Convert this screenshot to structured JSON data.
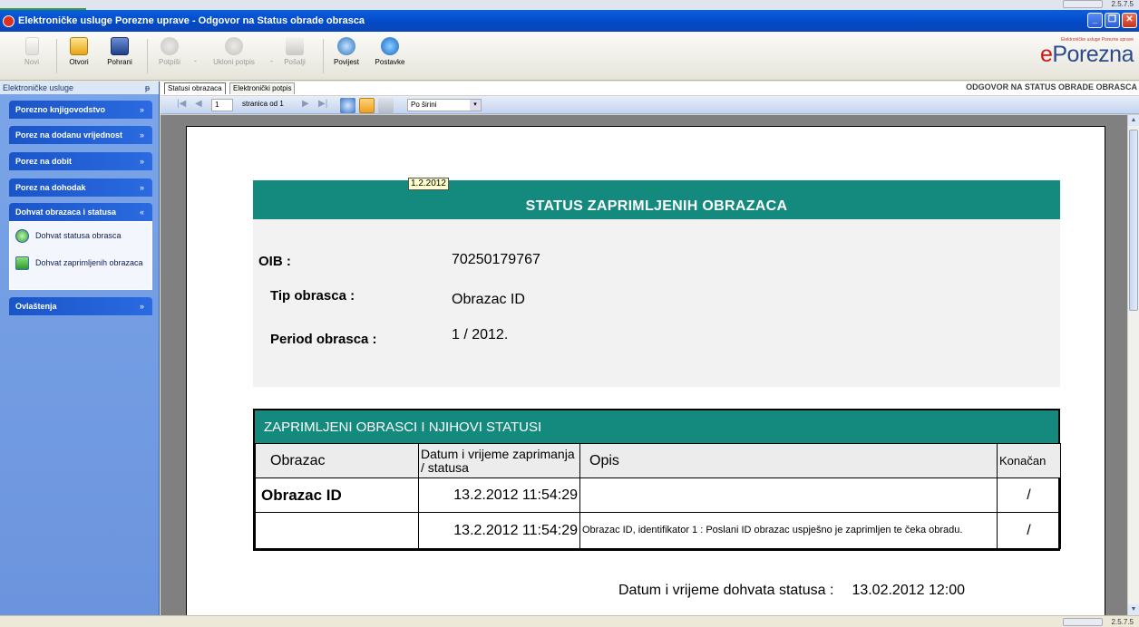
{
  "version": "2.5.7.5",
  "window": {
    "title": "Elektroničke usluge Porezne uprave - Odgovor na Status obrade obrasca",
    "minimize": "_",
    "restore": "❐",
    "close": "✕"
  },
  "toolbar": {
    "items": [
      {
        "label": "Novi",
        "icon": "new-document-icon",
        "enabled": false
      },
      {
        "label": "Otvori",
        "icon": "open-folder-icon",
        "enabled": true
      },
      {
        "label": "Pohrani",
        "icon": "save-icon",
        "enabled": true
      },
      {
        "label": "Potpiši",
        "icon": "sign-icon",
        "enabled": false
      },
      {
        "label": "Ukloni potpis",
        "icon": "remove-signature-icon",
        "enabled": false
      },
      {
        "label": "Pošalji",
        "icon": "send-icon",
        "enabled": false
      },
      {
        "label": "Povijest",
        "icon": "history-icon",
        "enabled": true
      },
      {
        "label": "Postavke",
        "icon": "settings-gear-icon",
        "enabled": true
      }
    ],
    "logo": {
      "prefix": "e",
      "text": "Porezna",
      "tagline": "Elektroničke usluge Porezne uprave"
    }
  },
  "sidebar": {
    "header": "Elektroničke usluge",
    "pin": "ᵽ",
    "groups": [
      {
        "label": "Porezno knjigovodstvo",
        "chevron": "»"
      },
      {
        "label": "Porez na dodanu vrijednost",
        "chevron": "»"
      },
      {
        "label": "Porez na dobit",
        "chevron": "»"
      },
      {
        "label": "Porez na dohodak",
        "chevron": "»"
      },
      {
        "label": "Dohvat obrazaca i statusa",
        "chevron": "«"
      },
      {
        "label": "Ovlaštenja",
        "chevron": "»"
      }
    ],
    "open_group_items": [
      {
        "label": "Dohvat statusa obrasca",
        "icon": "status-globe-icon"
      },
      {
        "label": "Dohvat zaprimljenih obrazaca",
        "icon": "download-arrow-icon"
      }
    ]
  },
  "main": {
    "tabs": [
      {
        "label": "Statusi obrazaca",
        "active": true
      },
      {
        "label": "Elektronički potpis",
        "active": false
      }
    ],
    "title": "ODGOVOR NA STATUS OBRADE OBRASCA",
    "nav": {
      "first": "|◀",
      "prev": "◀",
      "page": "1",
      "of_text": "stranica od  1",
      "next": "▶",
      "last": "▶|",
      "zoom": "Po širini",
      "zoom_arrow": "▾"
    }
  },
  "report": {
    "date_stamp": "1.2.2012",
    "heading": "STATUS ZAPRIMLJENIH OBRAZACA",
    "fields": [
      {
        "label": "OIB :",
        "value": "70250179767"
      },
      {
        "label": "Tip obrasca :",
        "value": "Obrazac ID"
      },
      {
        "label": "Period obrasca :",
        "value": "1 / 2012."
      }
    ],
    "table": {
      "title": "ZAPRIMLJENI OBRASCI I NJIHOVI STATUSI",
      "columns": [
        "Obrazac",
        "Datum  i vrijeme zaprimanja / statusa",
        "Opis",
        "Konačan"
      ],
      "rows": [
        {
          "obrazac": "Obrazac ID",
          "datum": "13.2.2012 11:54:29",
          "opis": "",
          "konacan": "/"
        },
        {
          "obrazac": "",
          "datum": "13.2.2012 11:54:29",
          "opis": "Obrazac ID, identifikator 1 : Poslani ID obrazac uspješno je zaprimljen te čeka obradu.",
          "konacan": "/"
        }
      ]
    },
    "footer_label": "Datum i vrijeme dohvata statusa :",
    "footer_value": "13.02.2012  12:00"
  },
  "scroll": {
    "up": "▲",
    "down": "▼"
  }
}
